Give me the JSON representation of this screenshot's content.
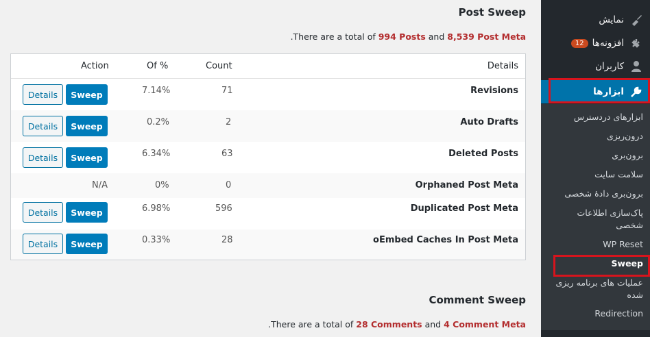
{
  "post_sweep": {
    "title": "Post Sweep",
    "summary_pre": "There are a total of ",
    "posts": "994 Posts",
    "and": " and ",
    "post_meta": "8,539 Post Meta",
    "summary_post": "."
  },
  "table": {
    "headers": {
      "details": "Details",
      "count": "Count",
      "of": "Of %",
      "action": "Action"
    },
    "rows": [
      {
        "label": "Revisions",
        "count": "71",
        "percent": "7.14%",
        "details_btn": "Details",
        "sweep_btn": "Sweep"
      },
      {
        "label": "Auto Drafts",
        "count": "2",
        "percent": "0.2%",
        "details_btn": "Details",
        "sweep_btn": "Sweep"
      },
      {
        "label": "Deleted Posts",
        "count": "63",
        "percent": "6.34%",
        "details_btn": "Details",
        "sweep_btn": "Sweep"
      },
      {
        "label": "Orphaned Post Meta",
        "count": "0",
        "percent": "0%",
        "action": "N/A"
      },
      {
        "label": "Duplicated Post Meta",
        "count": "596",
        "percent": "6.98%",
        "details_btn": "Details",
        "sweep_btn": "Sweep"
      },
      {
        "label": "oEmbed Caches In Post Meta",
        "count": "28",
        "percent": "0.33%",
        "details_btn": "Details",
        "sweep_btn": "Sweep"
      }
    ]
  },
  "comment_sweep": {
    "title": "Comment Sweep",
    "summary_pre": "There are a total of ",
    "comments": "28 Comments",
    "and": " and ",
    "comment_meta": "4 Comment Meta",
    "summary_post": "."
  },
  "sidebar": {
    "appearance": "نمایش",
    "plugins": "افزونه‌ها",
    "plugins_badge": "12",
    "users": "کاربران",
    "tools": "ابزارها",
    "sub": [
      "ابزارهای دردسترس",
      "درون‌ریزی",
      "برون‌بری",
      "سلامت سایت",
      "برون‌بری دادهٔ شخصی",
      "پاک‌سازی اطلاعات شخصی",
      "WP Reset",
      "Sweep",
      "عملیات های برنامه ریزی شده",
      "Redirection"
    ]
  },
  "colors": {
    "accent": "#007cba",
    "highlight": "#d7141d",
    "number": "#b32d2e"
  }
}
